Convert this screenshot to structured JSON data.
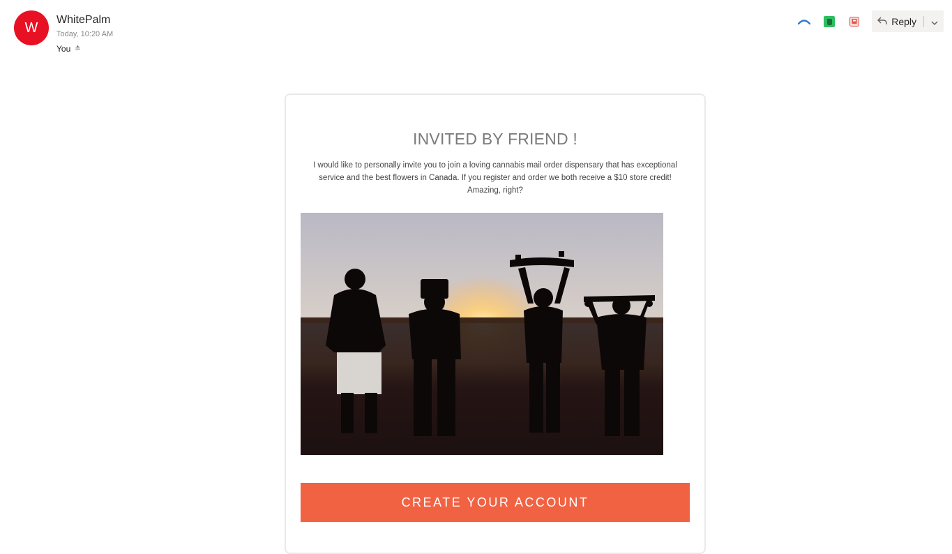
{
  "message": {
    "sender_initial": "W",
    "sender_name": "WhitePalm",
    "timestamp": "Today, 10:20 AM",
    "recipient": "You",
    "avatar_color": "#e81123"
  },
  "toolbar": {
    "reply_label": "Reply",
    "icons": [
      "arrow-up-icon",
      "evernote-icon",
      "pdf-icon",
      "reply-icon",
      "chevron-down-icon"
    ]
  },
  "email": {
    "title": "INVITED BY FRIEND !",
    "body": "I would like to personally invite you to join a loving cannabis mail order dispensary that has exceptional service and the best flowers in Canada. If you register and order we both receive a $10 store credit! Amazing, right?",
    "cta_label": "CREATE YOUR ACCOUNT",
    "cta_color": "#f16243"
  }
}
